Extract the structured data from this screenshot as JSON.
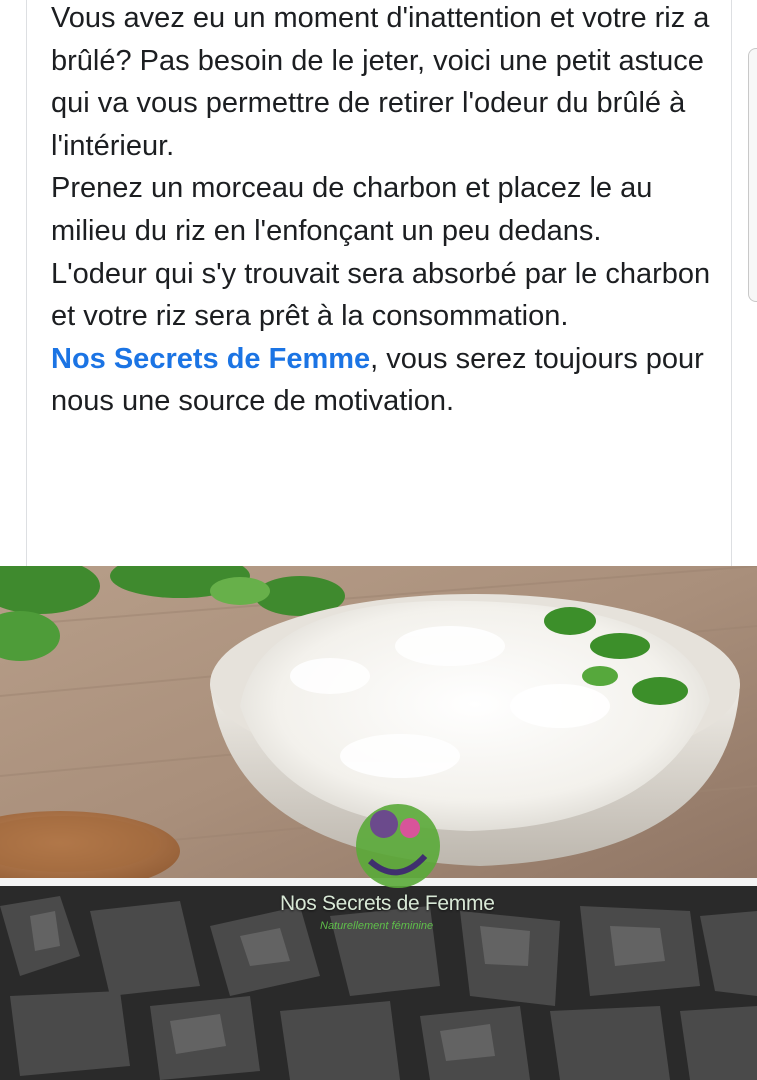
{
  "post": {
    "paragraph_1": "Vous avez eu un moment d'inattention et votre riz a brûlé? Pas besoin de le jeter, voici une petit astuce qui va vous permettre de retirer l'odeur du brûlé à l'intérieur.",
    "paragraph_2": "Prenez un morceau de charbon et placez le au milieu du riz en l'enfonçant un peu dedans.",
    "paragraph_3": "L'odeur qui s'y trouvait sera absorbé par le charbon et votre riz sera prêt à la consommation.",
    "page_link": "Nos Secrets de Femme",
    "closing_text": ", vous serez toujours pour nous une source de motivation."
  },
  "image": {
    "watermark_name": "Nos Secrets de Femme",
    "watermark_tagline": "Naturellement féminine"
  },
  "colors": {
    "text": "#1c1e21",
    "link": "#1b74e4",
    "divider": "#dddfe2"
  }
}
